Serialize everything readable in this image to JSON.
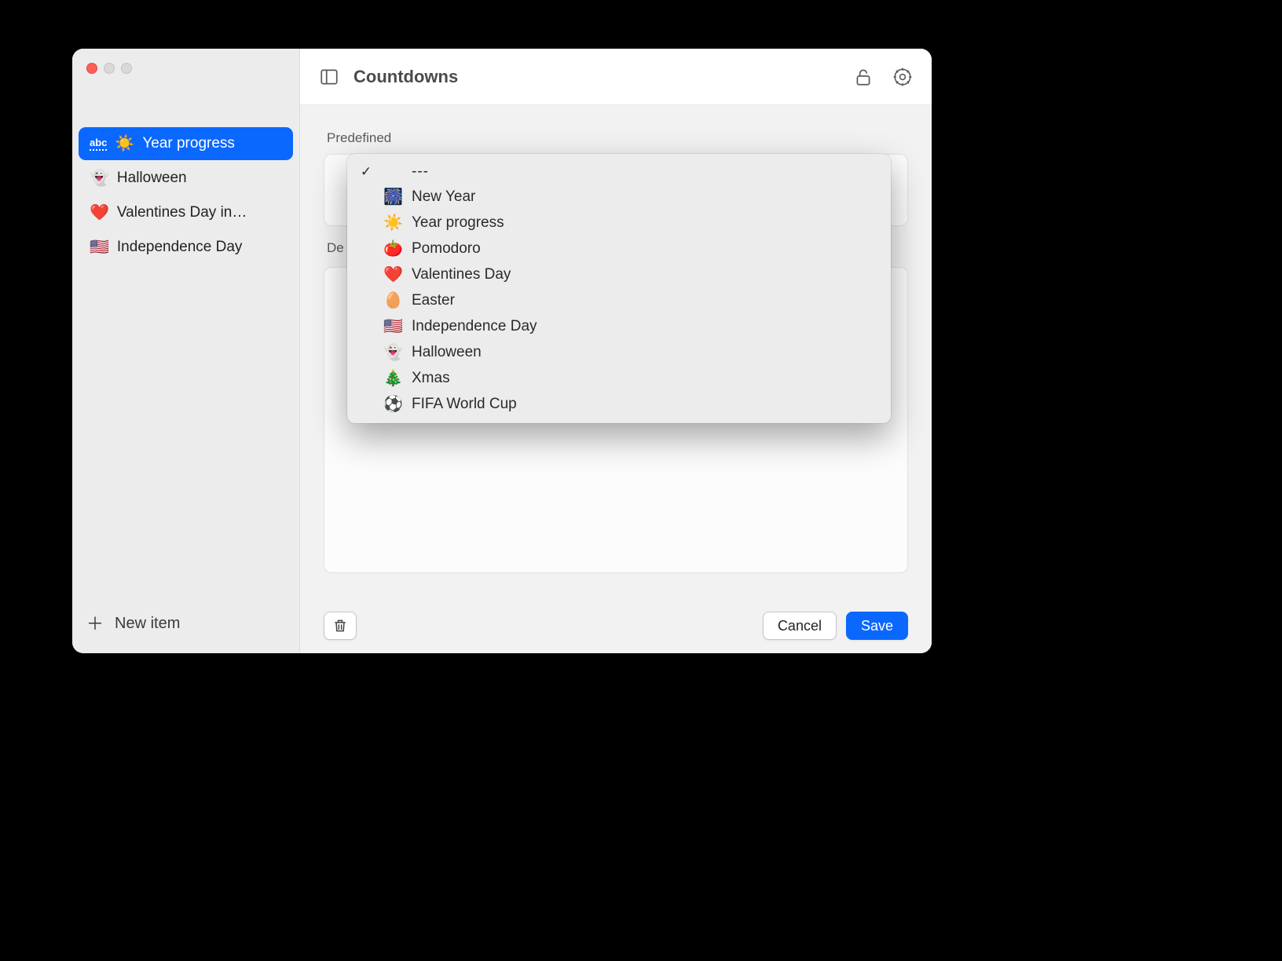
{
  "header": {
    "title": "Countdowns"
  },
  "sidebar": {
    "items": [
      {
        "icon": "☀️",
        "label": "Year progress",
        "selected": true,
        "editing": true,
        "editBadge": "abc"
      },
      {
        "icon": "👻",
        "label": "Halloween"
      },
      {
        "icon": "❤️",
        "label": "Valentines Day in…"
      },
      {
        "icon": "🇺🇸",
        "label": "Independence Day"
      }
    ],
    "newItemLabel": "New item"
  },
  "form": {
    "predefinedLabel": "Predefined",
    "secondSectionLabelPartial": "De"
  },
  "dropdown": {
    "selectedLabel": "---",
    "options": [
      {
        "icon": "",
        "label": "---",
        "checked": true
      },
      {
        "icon": "🎆",
        "label": "New Year"
      },
      {
        "icon": "☀️",
        "label": "Year progress"
      },
      {
        "icon": "🍅",
        "label": "Pomodoro"
      },
      {
        "icon": "❤️",
        "label": "Valentines Day"
      },
      {
        "icon": "🥚",
        "label": "Easter"
      },
      {
        "icon": "🇺🇸",
        "label": "Independence Day"
      },
      {
        "icon": "👻",
        "label": "Halloween"
      },
      {
        "icon": "🎄",
        "label": "Xmas"
      },
      {
        "icon": "⚽",
        "label": "FIFA World Cup"
      }
    ]
  },
  "actions": {
    "cancel": "Cancel",
    "save": "Save"
  }
}
